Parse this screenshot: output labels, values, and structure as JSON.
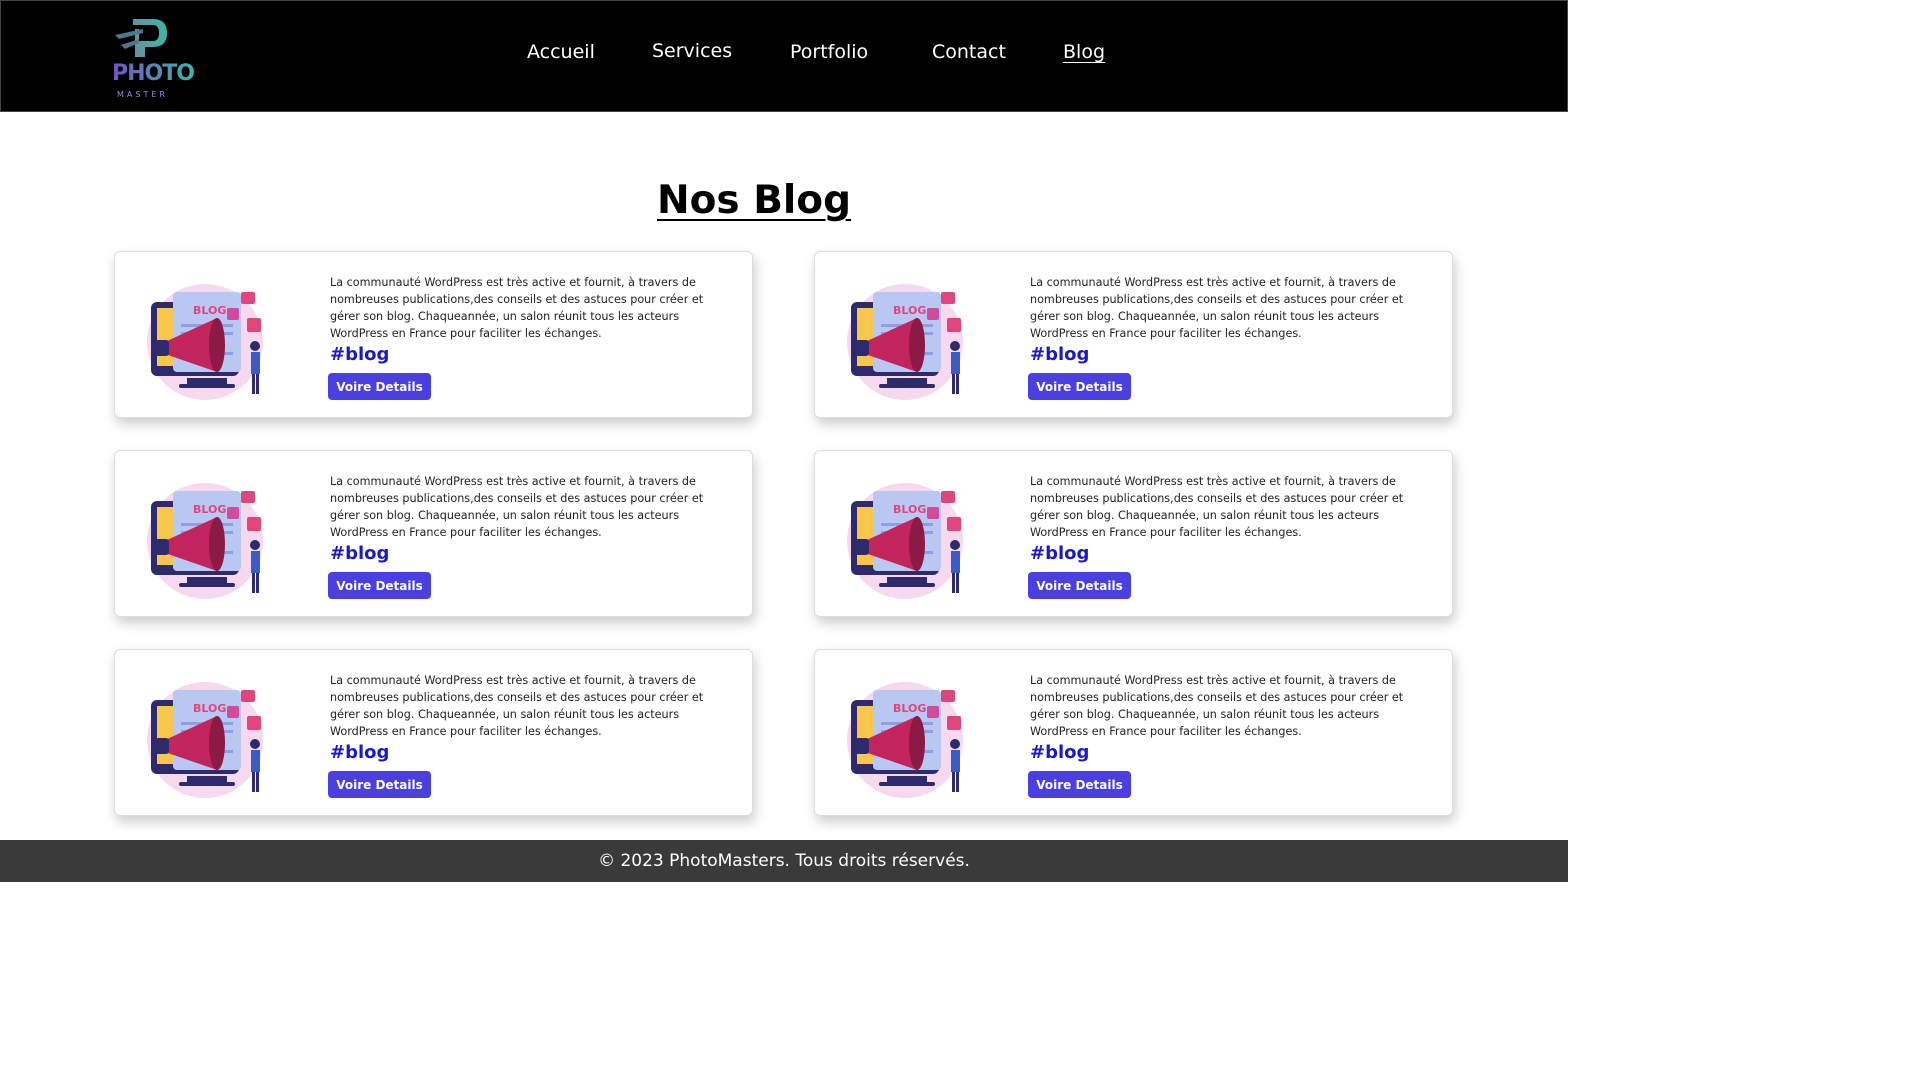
{
  "header": {
    "logo_text": "PHOTO",
    "logo_sub": "MASTER",
    "nav": [
      {
        "label": "Accueil"
      },
      {
        "label": "Services"
      },
      {
        "label": "Portfolio"
      },
      {
        "label": "Contact"
      },
      {
        "label": "Blog",
        "active": true
      }
    ]
  },
  "main": {
    "title": "Nos Blog",
    "cards": [
      {
        "text": "La communauté WordPress est très active et fournit, à travers de nombreuses publications,des conseils et des astuces pour créer et gérer son blog. Chaqueannée, un salon réunit tous les acteurs WordPress en France pour faciliter les échanges.",
        "tag": "#blog",
        "button": "Voire Details"
      },
      {
        "text": "La communauté WordPress est très active et fournit, à travers de nombreuses publications,des conseils et des astuces pour créer et gérer son blog. Chaqueannée, un salon réunit tous les acteurs WordPress en France pour faciliter les échanges.",
        "tag": "#blog",
        "button": "Voire Details"
      },
      {
        "text": "La communauté WordPress est très active et fournit, à travers de nombreuses publications,des conseils et des astuces pour créer et gérer son blog. Chaqueannée, un salon réunit tous les acteurs WordPress en France pour faciliter les échanges.",
        "tag": "#blog",
        "button": "Voire Details"
      },
      {
        "text": "La communauté WordPress est très active et fournit, à travers de nombreuses publications,des conseils et des astuces pour créer et gérer son blog. Chaqueannée, un salon réunit tous les acteurs WordPress en France pour faciliter les échanges.",
        "tag": "#blog",
        "button": "Voire Details"
      },
      {
        "text": "La communauté WordPress est très active et fournit, à travers de nombreuses publications,des conseils et des astuces pour créer et gérer son blog. Chaqueannée, un salon réunit tous les acteurs WordPress en France pour faciliter les échanges.",
        "tag": "#blog",
        "button": "Voire Details"
      },
      {
        "text": "La communauté WordPress est très active et fournit, à travers de nombreuses publications,des conseils et des astuces pour créer et gérer son blog. Chaqueannée, un salon réunit tous les acteurs WordPress en France pour faciliter les échanges.",
        "tag": "#blog",
        "button": "Voire Details"
      }
    ],
    "illustration_label": "BLOG"
  },
  "footer": {
    "text": "© 2023 PhotoMasters. Tous droits réservés."
  },
  "colors": {
    "accent": "#4a3fe0",
    "tag": "#1919c8",
    "nav_bg": "#000000",
    "footer_bg": "#3a3a3a"
  }
}
